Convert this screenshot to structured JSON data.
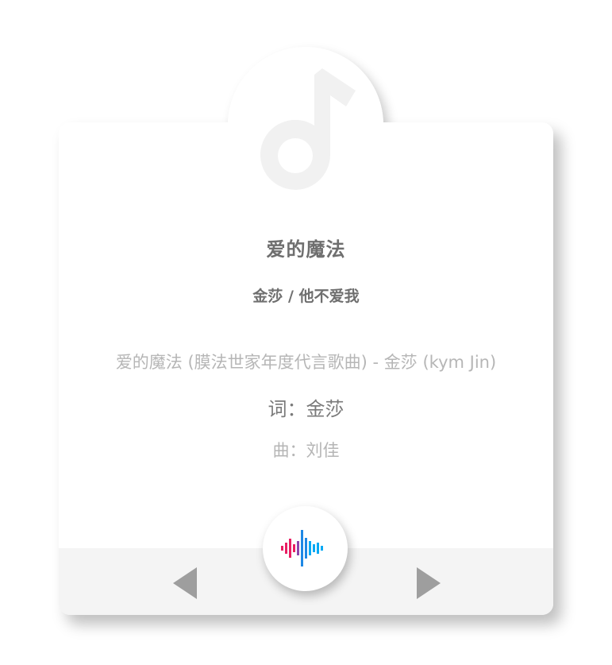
{
  "player": {
    "song_title": "爱的魔法",
    "artist_line": "金莎 / 他不爱我",
    "lyrics": [
      "爱的魔法 (膜法世家年度代言歌曲) - 金莎 (kym Jin)",
      "词：金莎",
      "曲：刘佳"
    ]
  },
  "icons": {
    "cover": "music-note-icon",
    "play": "audio-waveform-icon",
    "prev": "previous-triangle-icon",
    "next": "next-triangle-icon"
  },
  "colors": {
    "waveform_pink": "#e91e63",
    "waveform_blue": "#1e88e5",
    "waveform_cyan": "#03a9f4",
    "nav_gray": "#9e9e9e"
  }
}
